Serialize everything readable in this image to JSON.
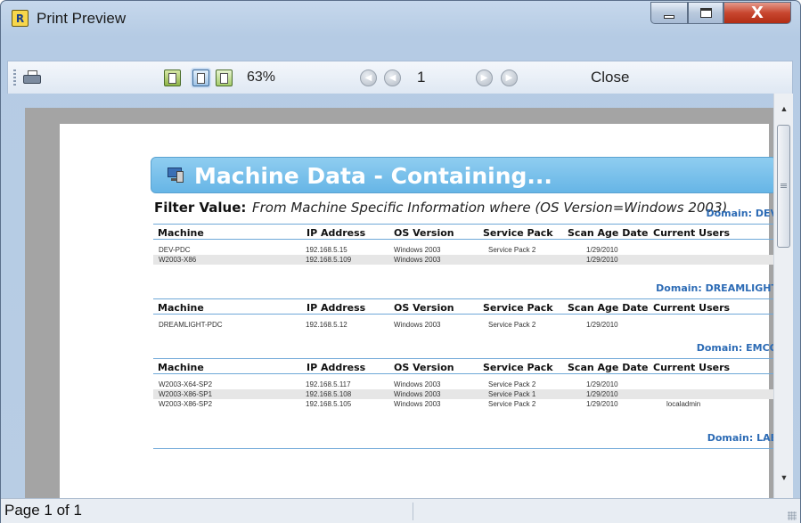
{
  "window": {
    "title": "Print Preview",
    "app_icon_letter": "R",
    "controls": {
      "minimize": "minimize",
      "maximize": "maximize",
      "close": "X"
    }
  },
  "toolbar": {
    "zoom": "63%",
    "page_number": "1",
    "close_label": "Close",
    "icons": [
      "printer-icon",
      "one-page-icon",
      "two-page-icon",
      "multi-page-icon",
      "first-page-icon",
      "previous-page-icon",
      "next-page-icon",
      "last-page-icon"
    ]
  },
  "report": {
    "title": "Machine Data - Containing...",
    "filter_label": "Filter Value:",
    "filter_value": "From Machine Specific Information where (OS Version=Windows 2003)",
    "columns": [
      "Machine",
      "IP Address",
      "OS Version",
      "Service Pack",
      "Scan Age Date",
      "Current Users"
    ],
    "groups": [
      {
        "domain": "Domain: DEV",
        "rows": [
          [
            "DEV-PDC",
            "192.168.5.15",
            "Windows 2003",
            "Service Pack 2",
            "1/29/2010",
            ""
          ],
          [
            "W2003-X86",
            "192.168.5.109",
            "Windows 2003",
            "",
            "1/29/2010",
            ""
          ]
        ]
      },
      {
        "domain": "Domain: DREAMLIGHT",
        "rows": [
          [
            "DREAMLIGHT-PDC",
            "192.168.5.12",
            "Windows 2003",
            "Service Pack 2",
            "1/29/2010",
            ""
          ]
        ]
      },
      {
        "domain": "Domain: EMCO",
        "rows": [
          [
            "W2003-X64-SP2",
            "192.168.5.117",
            "Windows 2003",
            "Service Pack 2",
            "1/29/2010",
            ""
          ],
          [
            "W2003-X86-SP1",
            "192.168.5.108",
            "Windows 2003",
            "Service Pack 1",
            "1/29/2010",
            ""
          ],
          [
            "W2003-X86-SP2",
            "192.168.5.105",
            "Windows 2003",
            "Service Pack 2",
            "1/29/2010",
            "localadmin"
          ]
        ]
      },
      {
        "domain": "Domain: LAB",
        "rows": []
      }
    ]
  },
  "status": {
    "page_info": "Page 1 of 1"
  },
  "colors": {
    "banner": "#66b5e6",
    "domain_text": "#2c6bb5",
    "rule": "#6fa8d8",
    "preview_bg": "#a4a4a4"
  }
}
